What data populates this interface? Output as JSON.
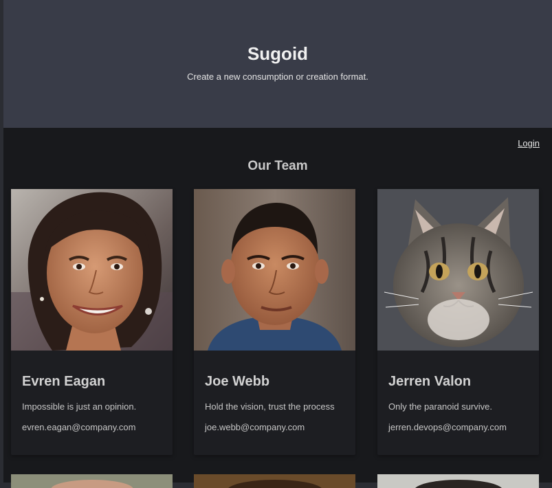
{
  "hero": {
    "title": "Sugoid",
    "subtitle": "Create a new consumption or creation format."
  },
  "nav": {
    "login_label": "Login"
  },
  "team": {
    "title": "Our Team",
    "members": [
      {
        "name": "Evren Eagan",
        "quote": "Impossible is just an opinion.",
        "email": "evren.eagan@company.com",
        "photo_icon": "woman-portrait"
      },
      {
        "name": "Joe Webb",
        "quote": "Hold the vision, trust the process",
        "email": "joe.webb@company.com",
        "photo_icon": "man-portrait"
      },
      {
        "name": "Jerren Valon",
        "quote": "Only the paranoid survive.",
        "email": "jerren.devops@company.com",
        "photo_icon": "cat-portrait"
      }
    ]
  },
  "colors": {
    "hero_bg": "#393c48",
    "page_bg": "#18191c",
    "card_bg": "#1d1e22"
  }
}
